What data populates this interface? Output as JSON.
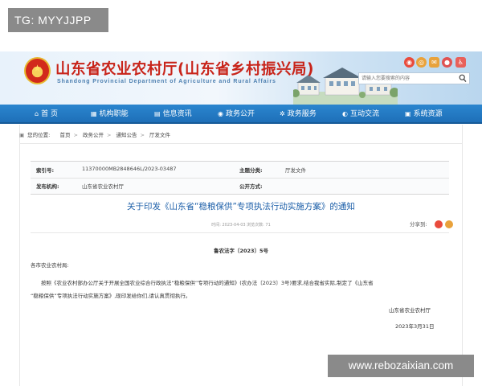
{
  "overlay_tag": "TG: MYYJJPP",
  "watermark": "www.rebozaixian.com",
  "header": {
    "title": "山东省农业农村厅(山东省乡村振兴局)",
    "subtitle": "Shandong Provincial Department of Agriculture and Rural Affairs",
    "search": {
      "placeholder": "请输入您要搜索的内容"
    },
    "social_icons": [
      "weibo-icon",
      "wechat-icon",
      "email-icon",
      "accessibility-icon"
    ],
    "social_colors": [
      "#e94b3c",
      "#e9a23b",
      "#d9534f",
      "#e8605a"
    ]
  },
  "nav": {
    "items": [
      {
        "label": "首 页",
        "icon": "home-icon",
        "glyph": "⌂"
      },
      {
        "label": "机构职能",
        "icon": "org-icon",
        "glyph": "▦"
      },
      {
        "label": "信息资讯",
        "icon": "news-icon",
        "glyph": "▤"
      },
      {
        "label": "政务公开",
        "icon": "open-gov-icon",
        "glyph": "◉"
      },
      {
        "label": "政务服务",
        "icon": "service-icon",
        "glyph": "✲"
      },
      {
        "label": "互动交流",
        "icon": "interaction-icon",
        "glyph": "◐"
      },
      {
        "label": "系统资源",
        "icon": "resources-icon",
        "glyph": "▣"
      }
    ]
  },
  "breadcrumb": {
    "label": "您的位置:",
    "items": [
      "首页",
      "政务公开",
      "通知公告",
      "厅发文件"
    ],
    "separator": ">"
  },
  "meta": {
    "index_label": "索引号:",
    "index_value": "11370000MB2848646L/2023-03487",
    "category_label": "主题分类:",
    "category_value": "厅发文件",
    "issuer_label": "发布机构:",
    "issuer_value": "山东省农业农村厅",
    "mode_label": "公开方式:",
    "mode_value": ""
  },
  "document": {
    "title": "关于印发《山东省“稳粮保供”专项执法行动实施方案》的通知",
    "date_line": "时间: 2023-04-03     浏览次数: 71",
    "share_label": "分享到:",
    "number": "鲁农法字〔2023〕5号",
    "salutation": "各市农业农村局:",
    "para_line1": "按照《农业农村部办公厅关于开展全国农业综合行政执法“稳粮保供”专项行动的通知》(农办法〔2023〕3号)要求,结合我省实际,制定了《山东省",
    "para_line2": "“稳粮保供”专项执法行动实施方案》,现印发给你们,请认真贯彻执行。",
    "signature": "山东省农业农村厅",
    "sign_date": "2023年3月31日"
  },
  "colors": {
    "brand_red": "#c8241a",
    "nav_blue": "#1e6fb8",
    "title_blue": "#1b5ea8"
  }
}
